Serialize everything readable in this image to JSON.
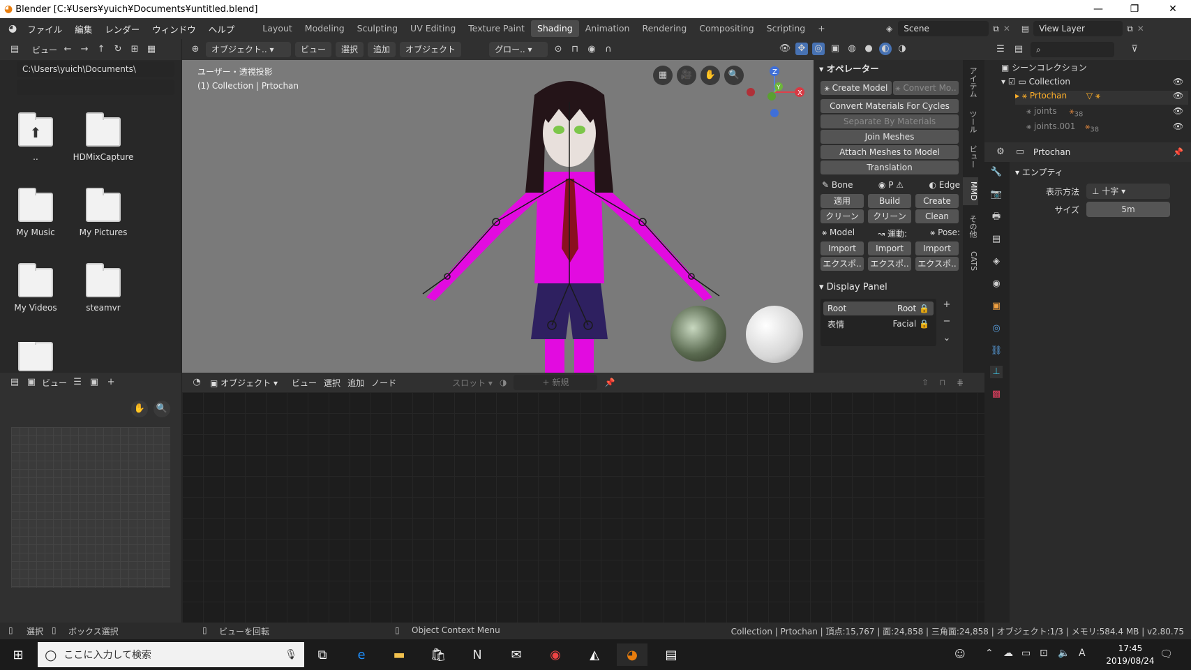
{
  "window": {
    "title": "Blender [C:¥Users¥yuich¥Documents¥untitled.blend]",
    "controls": [
      "—",
      "❐",
      "✕"
    ]
  },
  "menu": [
    "ファイル",
    "編集",
    "レンダー",
    "ウィンドウ",
    "ヘルプ"
  ],
  "workspaces": [
    "Layout",
    "Modeling",
    "Sculpting",
    "UV Editing",
    "Texture Paint",
    "Shading",
    "Animation",
    "Rendering",
    "Compositing",
    "Scripting"
  ],
  "active_workspace": "Shading",
  "scene": {
    "label": "Scene",
    "view_layer": "View Layer"
  },
  "filebrowser": {
    "view_label": "ビュー",
    "path": "C:\\Users\\yuich\\Documents\\",
    "items": [
      "..",
      "HDMixCapture",
      "My Music",
      "My Pictures",
      "My Videos",
      "steamvr",
      ""
    ]
  },
  "viewport": {
    "mode": "オブジェクト..",
    "menus": [
      "ビュー",
      "選択",
      "追加",
      "オブジェクト"
    ],
    "transform": "グロー..",
    "overlay_text_1": "ユーザー・透視投影",
    "overlay_text_2": "(1) Collection | Prtochan",
    "gizmo": {
      "z": "Z",
      "y": "Y",
      "x": "X"
    }
  },
  "npanel": {
    "operator_title": "オペレーター",
    "create_model": "Create Model",
    "convert_model": "Convert Mo..",
    "ops": [
      "Convert Materials For Cycles",
      "Separate By Materials",
      "Join Meshes",
      "Attach Meshes to Model",
      "Translation"
    ],
    "row_headers": {
      "bone": "Bone",
      "p": "P",
      "edge": "Edge"
    },
    "bone_row1": [
      "適用",
      "Build",
      "Create"
    ],
    "bone_row2": [
      "クリーン",
      "クリーン",
      "Clean"
    ],
    "model_headers": {
      "model": "Model",
      "motion": "運動:",
      "pose": "Pose:"
    },
    "import_row": [
      "Import",
      "Import",
      "Import"
    ],
    "export_row": [
      "エクスポ..",
      "エクスポ..",
      "エクスポ.."
    ],
    "display_panel_title": "Display Panel",
    "display_items": [
      {
        "name": "Root",
        "value": "Root"
      },
      {
        "name": "表情",
        "value": "Facial"
      }
    ],
    "tabs": [
      "アイテム",
      "ツール",
      "ビュー",
      "MMD",
      "その他",
      "CATS"
    ]
  },
  "outliner": {
    "root": "シーンコレクション",
    "collection": "Collection",
    "items": [
      "Prtochan",
      "joints",
      "joints.001"
    ],
    "badges": [
      "38",
      "38"
    ]
  },
  "properties": {
    "object_name": "Prtochan",
    "section": "エンプティ",
    "display_label": "表示方法",
    "display_value": "十字",
    "size_label": "サイズ",
    "size_value": "5m"
  },
  "nodeeditor": {
    "mode": "オブジェクト",
    "menus": [
      "ビュー",
      "選択",
      "追加",
      "ノード"
    ],
    "slot": "スロット",
    "new": "新規"
  },
  "imgeditor": {
    "view_label": "ビュー"
  },
  "status": {
    "select": "選択",
    "box_select": "ボックス選択",
    "rotate": "ビューを回転",
    "context": "Object Context Menu",
    "info": "Collection | Prtochan | 頂点:15,767 | 面:24,858 | 三角面:24,858 | オブジェクト:1/3 | メモリ:584.4 MB | v2.80.75"
  },
  "taskbar": {
    "search_placeholder": "ここに入力して検索",
    "time": "17:45",
    "date": "2019/08/24",
    "ime": "A"
  },
  "colors": {
    "accent": "#4772b3",
    "active_object": "#ffaf29",
    "character_body": "#e20be0"
  }
}
